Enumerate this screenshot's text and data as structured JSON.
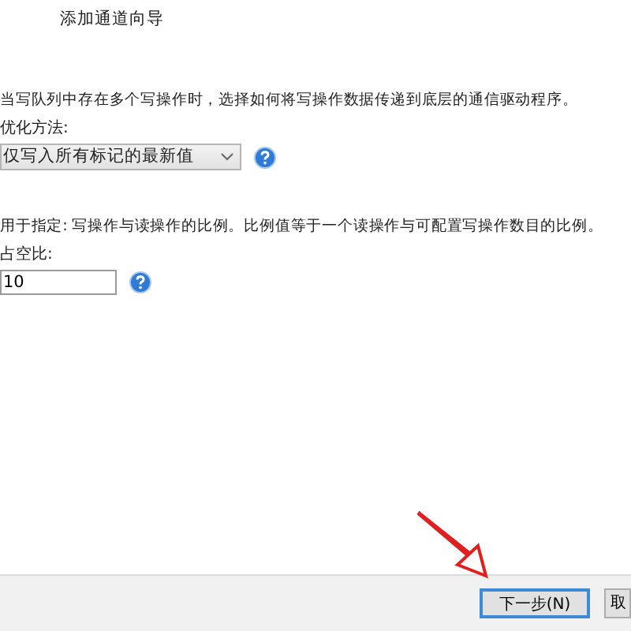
{
  "window": {
    "title": "添加通道向导"
  },
  "optimization": {
    "description": "当写队列中存在多个写操作时，选择如何将写操作数据传递到底层的通信驱动程序。",
    "label": "优化方法:",
    "value": "仅写入所有标记的最新值"
  },
  "duty_cycle": {
    "description": "用于指定: 写操作与读操作的比例。比例值等于一个读操作与可配置写操作数目的比例。",
    "label": "占空比:",
    "value": "10"
  },
  "buttons": [
    {
      "label": "下一步(N)",
      "focused": true
    },
    {
      "label": "取",
      "focused": false
    }
  ]
}
